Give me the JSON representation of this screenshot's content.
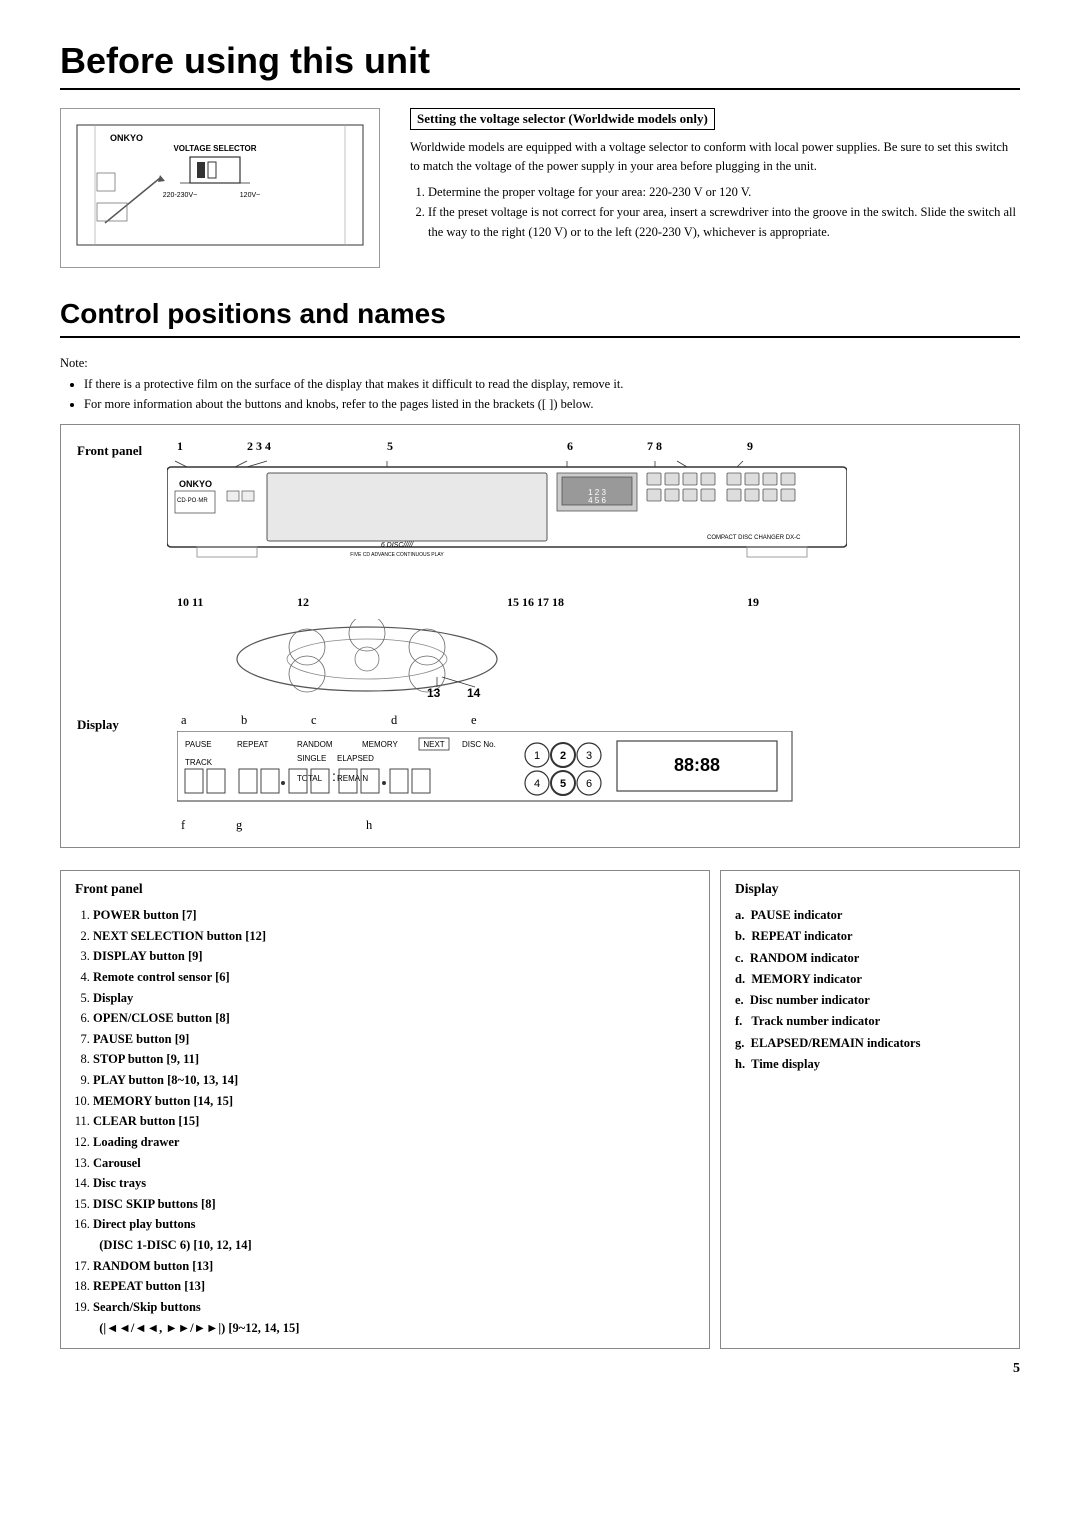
{
  "page": {
    "title": "Before using this unit",
    "section2_title": "Control positions and names",
    "page_number": "5"
  },
  "voltage": {
    "box_title": "Setting the voltage selector (Worldwide models only)",
    "intro": "Worldwide models are equipped with a voltage selector to conform with local power supplies. Be sure to set this switch to match the voltage of the power supply in your area before plugging in the unit.",
    "step1": "Determine the proper voltage for your area: 220-230 V or 120 V.",
    "step2": "If the preset voltage is not correct for your area, insert a screwdriver into the groove in the switch. Slide the switch all the way to the right (120 V) or to the left (220-230 V), whichever is appropriate.",
    "label": "VOLTAGE SELECTOR",
    "v1": "220-230V~",
    "v2": "120V~"
  },
  "notes": {
    "label": "Note:",
    "items": [
      "If there is a protective film on the surface of the display that makes it difficult to read the display, remove it.",
      "For more information about the buttons and knobs, refer to the pages listed in the brackets ([ ]) below."
    ]
  },
  "front_panel": {
    "label": "Front panel",
    "numbers_top": [
      "1",
      "2 3 4",
      "5",
      "6",
      "7  8",
      "9"
    ],
    "numbers_bottom": [
      "10 11",
      "12",
      "15 16 17 18",
      "19"
    ],
    "display_label": "Display",
    "display_letters_top": [
      "a",
      "b",
      "c",
      "d",
      "e"
    ],
    "display_letters_bottom": [
      "f",
      "g",
      "h"
    ]
  },
  "front_panel_list": {
    "title": "Front panel",
    "items": [
      "POWER button [7]",
      "NEXT SELECTION button [12]",
      "DISPLAY button [9]",
      "Remote control sensor [6]",
      "Display",
      "OPEN/CLOSE button [8]",
      "PAUSE button [9]",
      "STOP button [9, 11]",
      "PLAY button [8~10, 13, 14]",
      "MEMORY button [14, 15]",
      "CLEAR button [15]",
      "Loading drawer",
      "Carousel",
      "Disc trays",
      "DISC SKIP buttons [8]",
      "Direct play buttons (DISC 1-DISC 6) [10, 12, 14]",
      "RANDOM button [13]",
      "REPEAT button [13]",
      "Search/Skip buttons (|◄◄/◄◄, ►►/►►|) [9~12, 14, 15]"
    ]
  },
  "display_list": {
    "title": "Display",
    "items": [
      "PAUSE indicator",
      "REPEAT indicator",
      "RANDOM indicator",
      "MEMORY indicator",
      "Disc number indicator",
      "Track number indicator",
      "ELAPSED/REMAIN indicators",
      "Time display"
    ],
    "letters": [
      "a.",
      "b.",
      "c.",
      "d.",
      "e.",
      "f.",
      "g.",
      "h."
    ]
  },
  "display_indicators": {
    "pause": "PAUSE",
    "repeat": "REPEAT",
    "random": "RANDOM",
    "memory": "MEMORY",
    "next_box": "NEXT",
    "disc_no": "DISC No.",
    "track": "TRACK",
    "single": "SINGLE",
    "elapsed": "ELAPSED",
    "total": "TOTAL",
    "remain": "REMAIN"
  }
}
